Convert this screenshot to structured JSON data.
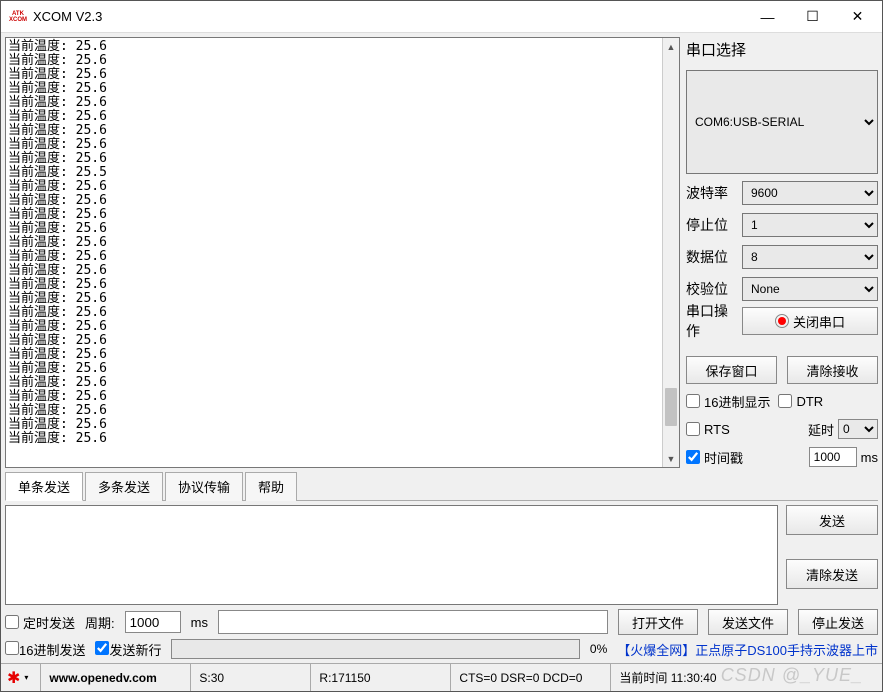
{
  "title": "XCOM V2.3",
  "app_icon": {
    "line1": "ATK",
    "line2": "XCOM"
  },
  "win": {
    "min": "—",
    "max": "☐",
    "close": "✕"
  },
  "recv_lines": [
    "当前温度: 25.6",
    "当前温度: 25.6",
    "当前温度: 25.6",
    "当前温度: 25.6",
    "当前温度: 25.6",
    "当前温度: 25.6",
    "当前温度: 25.6",
    "当前温度: 25.6",
    "当前温度: 25.6",
    "当前温度: 25.5",
    "当前温度: 25.6",
    "当前温度: 25.6",
    "当前温度: 25.6",
    "当前温度: 25.6",
    "当前温度: 25.6",
    "当前温度: 25.6",
    "当前温度: 25.6",
    "当前温度: 25.6",
    "当前温度: 25.6",
    "当前温度: 25.6",
    "当前温度: 25.6",
    "当前温度: 25.6",
    "当前温度: 25.6",
    "当前温度: 25.6",
    "当前温度: 25.6",
    "当前温度: 25.6",
    "当前温度: 25.6",
    "当前温度: 25.6",
    "当前温度: 25.6"
  ],
  "side": {
    "title": "串口选择",
    "port": "COM6:USB-SERIAL",
    "baud_label": "波特率",
    "baud": "9600",
    "stop_label": "停止位",
    "stop": "1",
    "data_label": "数据位",
    "data": "8",
    "parity_label": "校验位",
    "parity": "None",
    "op_label": "串口操作",
    "op_btn": "关闭串口",
    "save_btn": "保存窗口",
    "clear_btn": "清除接收",
    "hex_disp": "16进制显示",
    "dtr": "DTR",
    "rts": "RTS",
    "delay_label": "延时",
    "delay_val": "0",
    "timestamp": "时间戳",
    "ts_val": "1000",
    "ts_unit": "ms"
  },
  "tabs": {
    "t1": "单条发送",
    "t2": "多条发送",
    "t3": "协议传输",
    "t4": "帮助"
  },
  "send": {
    "send_btn": "发送",
    "clear_send_btn": "清除发送",
    "timed": "定时发送",
    "period_label": "周期:",
    "period": "1000",
    "period_unit": "ms",
    "open_file": "打开文件",
    "send_file": "发送文件",
    "stop_send": "停止发送",
    "hex_send": "16进制发送",
    "send_newline": "发送新行",
    "progress": "0%",
    "promo": "【火爆全网】正点原子DS100手持示波器上市"
  },
  "status": {
    "url": "www.openedv.com",
    "s": "S:30",
    "r": "R:171150",
    "line": "CTS=0 DSR=0 DCD=0",
    "time": "当前时间 11:30:40"
  },
  "watermark": "CSDN @_YUE_"
}
